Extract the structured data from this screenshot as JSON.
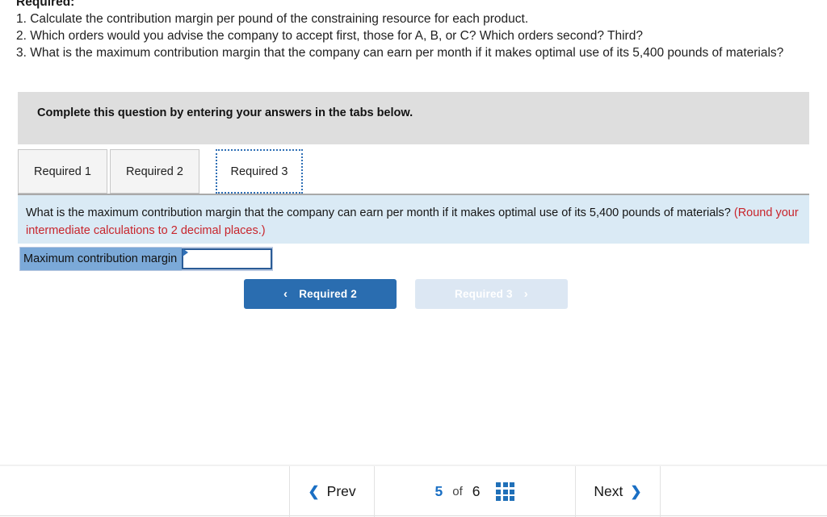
{
  "stem": {
    "title": "Required:",
    "items": [
      "1. Calculate the contribution margin per pound of the constraining resource for each product.",
      "2. Which orders would you advise the company to accept first, those for A, B, or C? Which orders second? Third?",
      "3. What is the maximum contribution margin that the company can earn per month if it makes optimal use of its 5,400 pounds of materials?"
    ]
  },
  "banner": {
    "text": "Complete this question by entering your answers in the tabs below."
  },
  "tabs": [
    {
      "label": "Required 1",
      "active": false
    },
    {
      "label": "Required 2",
      "active": false
    },
    {
      "label": "Required 3",
      "active": true
    }
  ],
  "question_panel": {
    "text": "What is the maximum contribution margin that the company can earn per month if it makes optimal use of its 5,400 pounds of materials? ",
    "note": "(Round your intermediate calculations to 2 decimal places.)"
  },
  "answer": {
    "label": "Maximum contribution margin",
    "value": "",
    "placeholder": ""
  },
  "required_nav": {
    "prev_label": "Required 2",
    "prev_icon": "chevron-left-icon",
    "next_label": "Required 3",
    "next_icon": "chevron-right-icon"
  },
  "footer": {
    "prev_label": "Prev",
    "prev_icon": "chevron-left-icon",
    "current_page": "5",
    "of_label": "of",
    "total_pages": "6",
    "grid_icon": "grid-3x3-icon",
    "next_label": "Next",
    "next_icon": "chevron-right-icon"
  },
  "colors": {
    "accent_blue": "#2a6db0",
    "link_blue": "#1a6fc4",
    "panel_blue": "#daeaf5",
    "label_blue": "#7ba9d8",
    "banner_gray": "#dedede",
    "note_red": "#c8252c"
  }
}
